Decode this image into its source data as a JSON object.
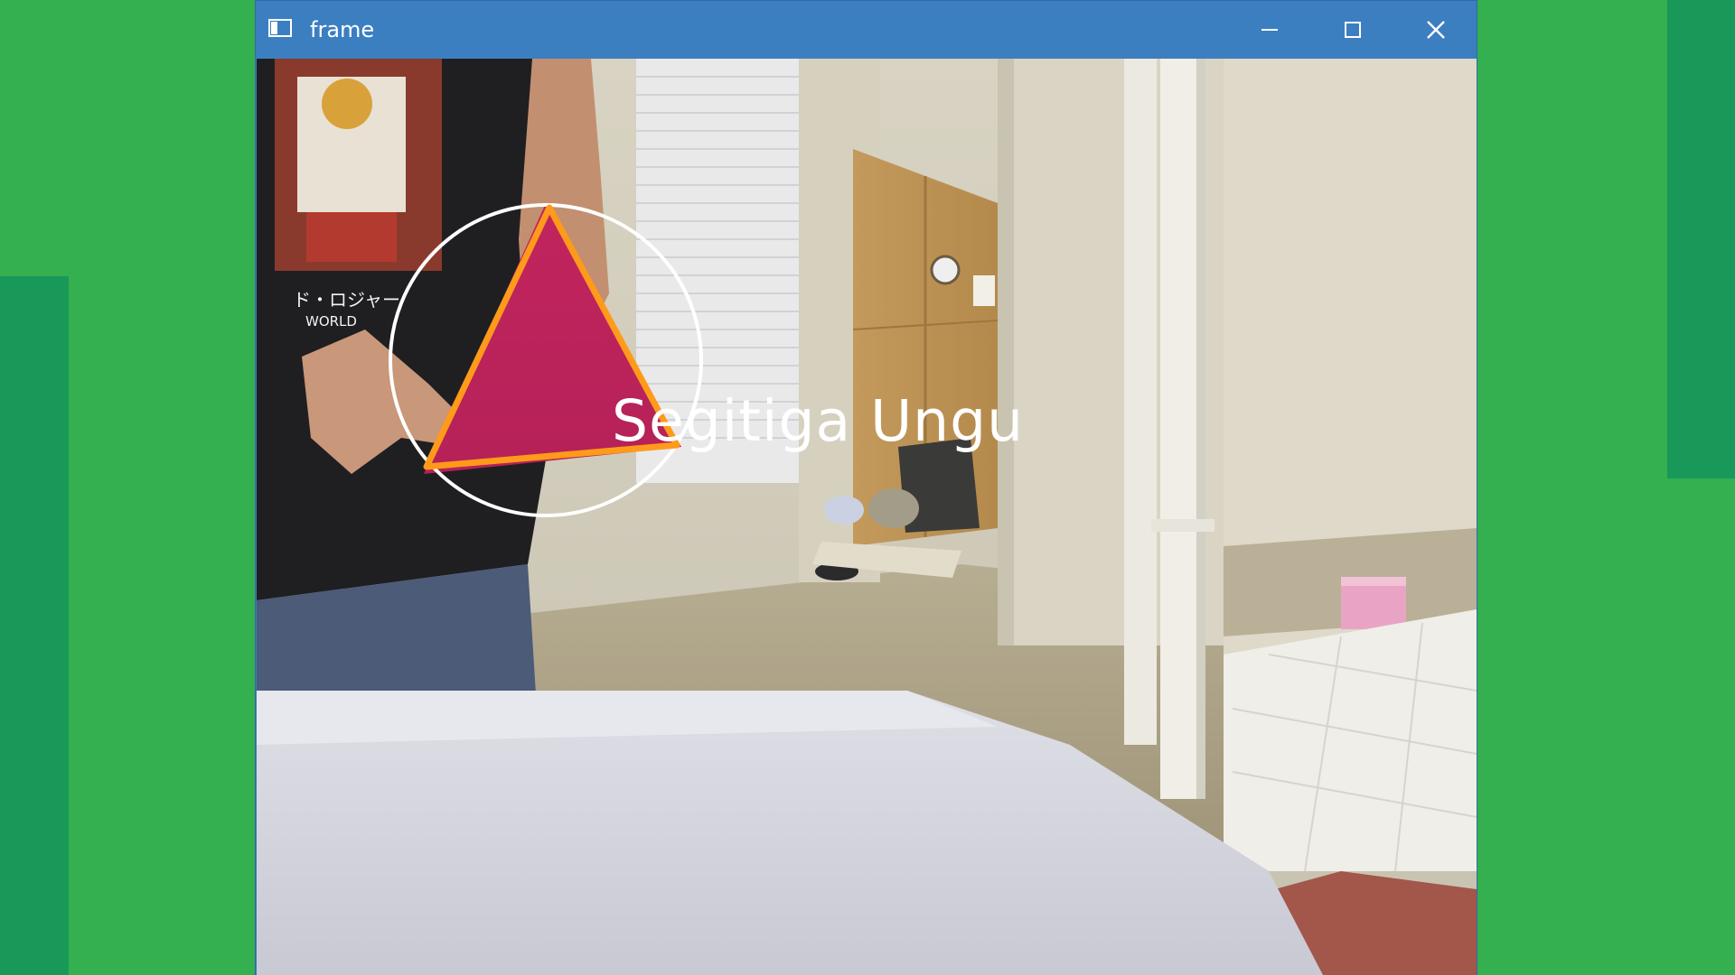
{
  "desktop": {
    "background_color": "#35b050",
    "accent_block_color": "#18995a"
  },
  "window": {
    "title": "frame",
    "titlebar_color": "#3b7fc1",
    "controls": [
      "minimize-icon",
      "maximize-icon",
      "close-icon"
    ]
  },
  "camera_feed": {
    "detection": {
      "label": "Segitiga Ungu",
      "shape": "triangle",
      "outline_color": "#ff9a1a",
      "circle_color": "#ffffff",
      "fill_color": "#c2245e"
    },
    "shirt_print": {
      "line1": "ド・ロジャー",
      "line2": "WORLD"
    }
  }
}
